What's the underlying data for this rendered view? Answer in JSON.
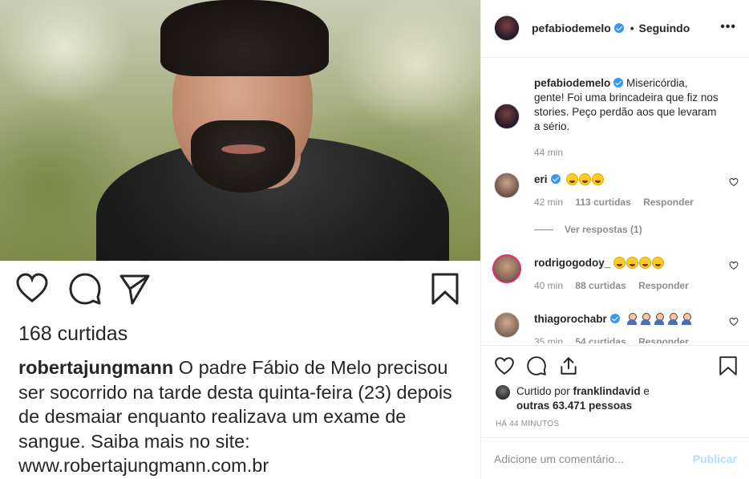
{
  "post_image": {
    "likes_text": "168 curtidas",
    "caption_user": "robertajungmann",
    "caption_text": " O padre Fábio de Melo precisou ser socorrido na tarde desta quinta-feira (23) depois de desmaiar enquanto realizava um exame de sangue. Saiba mais no site: www.robertajungmann.com.br",
    "icons": [
      "heart-icon",
      "comment-icon",
      "share-icon",
      "bookmark-icon"
    ]
  },
  "header": {
    "username": "pefabiodemelo",
    "separator": "•",
    "follow_status": "Seguindo",
    "more_label": "•••"
  },
  "caption": {
    "username": "pefabiodemelo",
    "text": " Misericórdia, gente! Foi uma brincadeira que fiz nos stories. Peço perdão aos que levaram a sério.",
    "time": "44 min"
  },
  "comments": [
    {
      "username": "eri",
      "time": "42 min",
      "likes": "113 curtidas",
      "reply": "Responder",
      "emoji_count": 3
    },
    {
      "username": "rodrigogodoy_",
      "time": "40 min",
      "likes": "88 curtidas",
      "reply": "Responder",
      "emoji_count": 4
    },
    {
      "username": "thiagorochabr",
      "time": "35 min",
      "likes": "54 curtidas",
      "reply": "Responder",
      "emoji_count": 5
    }
  ],
  "view_replies": "Ver respostas (1)",
  "liked_by": {
    "prefix": "Curtido por ",
    "user": "franklindavid",
    "middle": " e",
    "others": "outras 63.471 pessoas"
  },
  "time_ago": "HÁ 44 MINUTOS",
  "add_comment": {
    "placeholder": "Adicione um comentário...",
    "publish": "Publicar"
  },
  "colors": {
    "verified": "#3897f0",
    "muted": "#8e8e8e",
    "publish_disabled": "#b2dffc",
    "text": "#262626"
  }
}
